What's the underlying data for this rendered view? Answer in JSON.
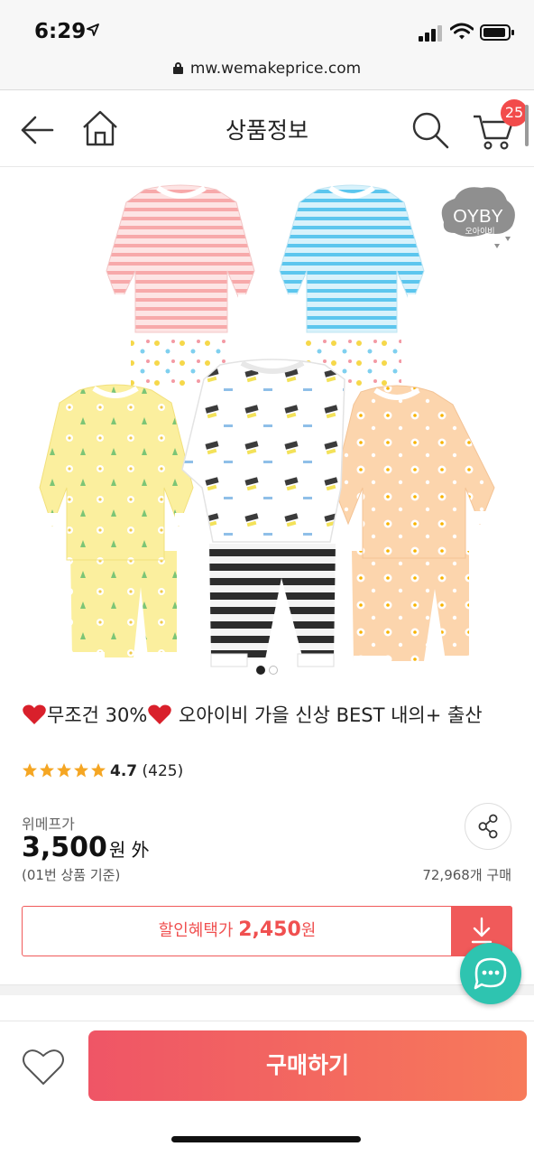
{
  "status_bar": {
    "time": "6:29"
  },
  "browser": {
    "url": "mw.wemakeprice.com"
  },
  "header": {
    "title": "상품정보",
    "cart_count": "25"
  },
  "brand_logo": {
    "text": "OYBY",
    "subtext": "오아이비"
  },
  "product": {
    "title_part1": "무조건 30%",
    "title_part2": " 오아이비 가을 신상 BEST 내의+ 출산",
    "rating_score": "4.7",
    "review_count": "(425)",
    "rating_stars": 5,
    "price_label": "위메프가",
    "price": "3,500",
    "price_suffix": "원 外",
    "price_note": "(01번 상품 기준)",
    "sold_count": "72,968개 구매"
  },
  "discount": {
    "label": "할인혜택가",
    "price": "2,450",
    "unit": "원"
  },
  "carousel": {
    "total": 2,
    "active": 1
  },
  "actions": {
    "buy_label": "구매하기"
  },
  "colors": {
    "accent": "#f05a5a",
    "chat": "#2ec4b0",
    "buy_start": "#ef5566",
    "buy_end": "#f77a5a",
    "star": "#f5a623"
  }
}
